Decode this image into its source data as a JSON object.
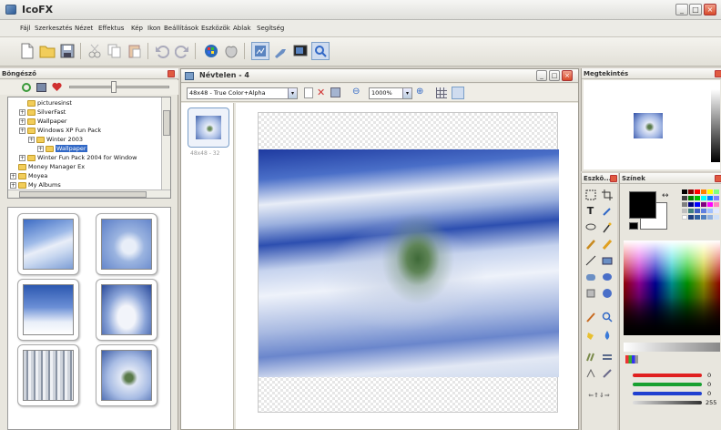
{
  "app": {
    "title": "IcoFX"
  },
  "window_buttons": [
    "_",
    "□",
    "×"
  ],
  "menu": [
    "Fájl",
    "Szerkesztés",
    "Nézet",
    "Effektus",
    "Kép",
    "Ikon",
    "Beállítások",
    "Eszközök",
    "Ablak",
    "Segítség"
  ],
  "toolbar_icons": [
    "new-icon",
    "open-icon",
    "save-icon",
    "cut-icon",
    "copy-icon",
    "paste-icon",
    "undo-icon",
    "redo-icon",
    "windows-icon",
    "apple-icon",
    "tool-a-icon",
    "tool-b-icon",
    "tool-c-icon",
    "tool-d-icon"
  ],
  "browser": {
    "title": "Böngésző",
    "tree": [
      {
        "label": "picturesinst",
        "level": 2,
        "expander": false
      },
      {
        "label": "SilverFast",
        "level": 2,
        "expander": true
      },
      {
        "label": "Wallpaper",
        "level": 2,
        "expander": true
      },
      {
        "label": "Windows XP Fun Pack",
        "level": 2,
        "expander": true
      },
      {
        "label": "Winter 2003",
        "level": 3,
        "expander": true
      },
      {
        "label": "Wallpaper",
        "level": 4,
        "expander": true,
        "selected": true
      },
      {
        "label": "Winter Fun Pack 2004 for Window",
        "level": 2,
        "expander": true
      },
      {
        "label": "Money Manager Ex",
        "level": 1,
        "expander": false
      },
      {
        "label": "Moyea",
        "level": 1,
        "expander": true
      },
      {
        "label": "My Albums",
        "level": 1,
        "expander": true
      }
    ]
  },
  "document": {
    "title": "Névtelen - 4",
    "format_select": "48x48 - True Color+Alpha",
    "zoom_select": "1000%",
    "icon_caption": "48x48 - 32"
  },
  "preview": {
    "title": "Megtekintés"
  },
  "tools": {
    "title": "Eszkö..."
  },
  "colors": {
    "title": "Színek",
    "sliders": [
      {
        "channel": "red",
        "value": "0",
        "color": "#e02020"
      },
      {
        "channel": "green",
        "value": "0",
        "color": "#18a030"
      },
      {
        "channel": "blue",
        "value": "0",
        "color": "#2040d0"
      },
      {
        "channel": "alpha",
        "value": "255",
        "color": "#555555"
      }
    ]
  },
  "accent": {
    "titlebar_text": "#2a2a2a",
    "close_red": "#d84a2a",
    "selection": "#3168c6"
  }
}
